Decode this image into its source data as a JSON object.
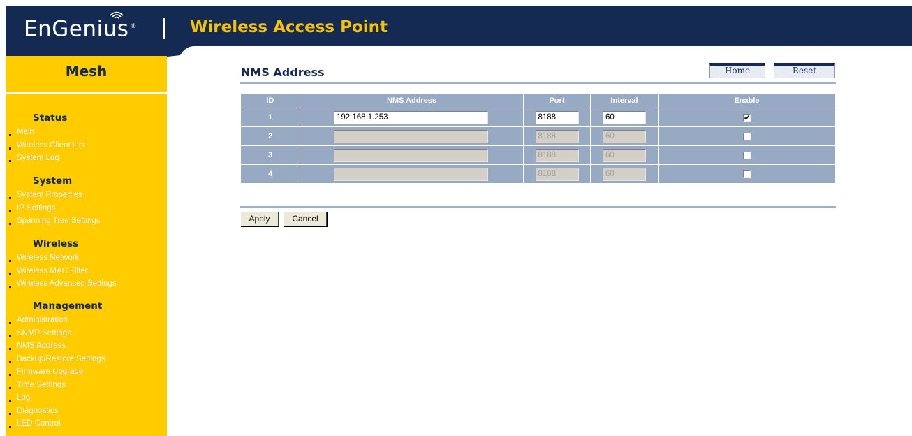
{
  "header": {
    "logo_text": "EnGenius",
    "logo_mark": "®",
    "app_title": "Wireless Access Point",
    "colors": {
      "bar": "#152a52",
      "title": "#f7c300"
    }
  },
  "sidebar": {
    "title": "Mesh",
    "background": "#ffcc00",
    "sections": [
      {
        "heading": "Status",
        "items": [
          "Main",
          "Wireless Client List",
          "System Log"
        ]
      },
      {
        "heading": "System",
        "items": [
          "System Properties",
          "IP Settings",
          "Spanning Tree Settings"
        ]
      },
      {
        "heading": "Wireless",
        "items": [
          "Wireless Network",
          "Wireless MAC Filter",
          "Wireless Advanced Settings"
        ]
      },
      {
        "heading": "Management",
        "items": [
          "Administration",
          "SNMP Settings",
          "NMS Address",
          "Backup/Restore Settings",
          "Firmware Upgrade",
          "Time Settings",
          "Log",
          "Diagnostics",
          "LED Control"
        ]
      }
    ]
  },
  "main": {
    "title": "NMS Address",
    "home_label": "Home",
    "reset_label": "Reset",
    "table": {
      "headers": {
        "id": "ID",
        "address": "NMS Address",
        "port": "Port",
        "interval": "Interval",
        "enable": "Enable"
      },
      "rows": [
        {
          "id": "1",
          "address": "192.168.1.253",
          "port": "8188",
          "interval": "60",
          "enabled": true
        },
        {
          "id": "2",
          "address": "",
          "port": "8188",
          "interval": "60",
          "enabled": false
        },
        {
          "id": "3",
          "address": "",
          "port": "8188",
          "interval": "60",
          "enabled": false
        },
        {
          "id": "4",
          "address": "",
          "port": "8188",
          "interval": "60",
          "enabled": false
        }
      ]
    },
    "apply_label": "Apply",
    "cancel_label": "Cancel"
  }
}
